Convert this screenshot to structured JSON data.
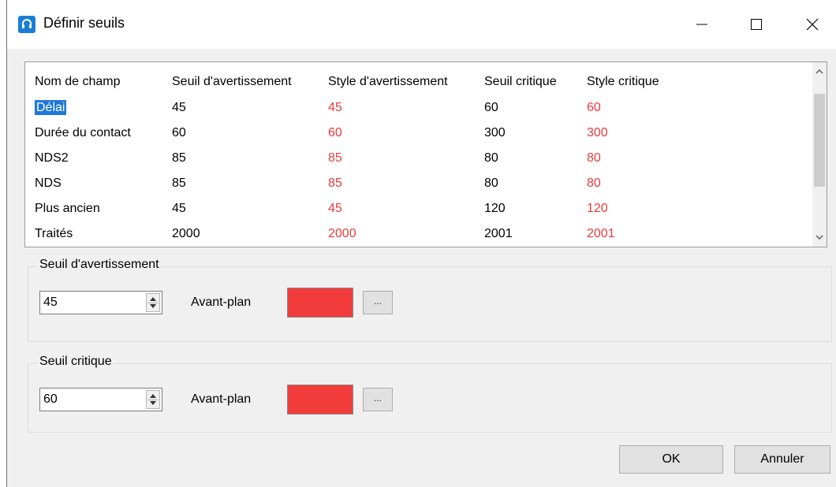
{
  "window": {
    "title": "Définir seuils"
  },
  "table": {
    "headers": [
      "Nom de champ",
      "Seuil d'avertissement",
      "Style d'avertissement",
      "Seuil critique",
      "Style critique"
    ],
    "rows": [
      [
        "Délai",
        "45",
        "45",
        "60",
        "60"
      ],
      [
        "Durée du contact",
        "60",
        "60",
        "300",
        "300"
      ],
      [
        "NDS2",
        "85",
        "85",
        "80",
        "80"
      ],
      [
        "NDS",
        "85",
        "85",
        "80",
        "80"
      ],
      [
        "Plus ancien",
        "45",
        "45",
        "120",
        "120"
      ],
      [
        "Traités",
        "2000",
        "2000",
        "2001",
        "2001"
      ]
    ],
    "selected_row": 0,
    "style_color": "#e83b3b",
    "selection_color": "#1e78d7"
  },
  "warning_group": {
    "label": "Seuil d'avertissement",
    "value": "45",
    "fg_label": "Avant-plan",
    "color": "#f23c3c",
    "dots_label": "..."
  },
  "critical_group": {
    "label": "Seuil critique",
    "value": "60",
    "fg_label": "Avant-plan",
    "color": "#f23c3c",
    "dots_label": "..."
  },
  "buttons": {
    "ok": "OK",
    "cancel": "Annuler"
  },
  "icons": {
    "app": "headset-icon",
    "minimize": "minimize-icon",
    "maximize": "maximize-icon",
    "close": "close-icon"
  }
}
